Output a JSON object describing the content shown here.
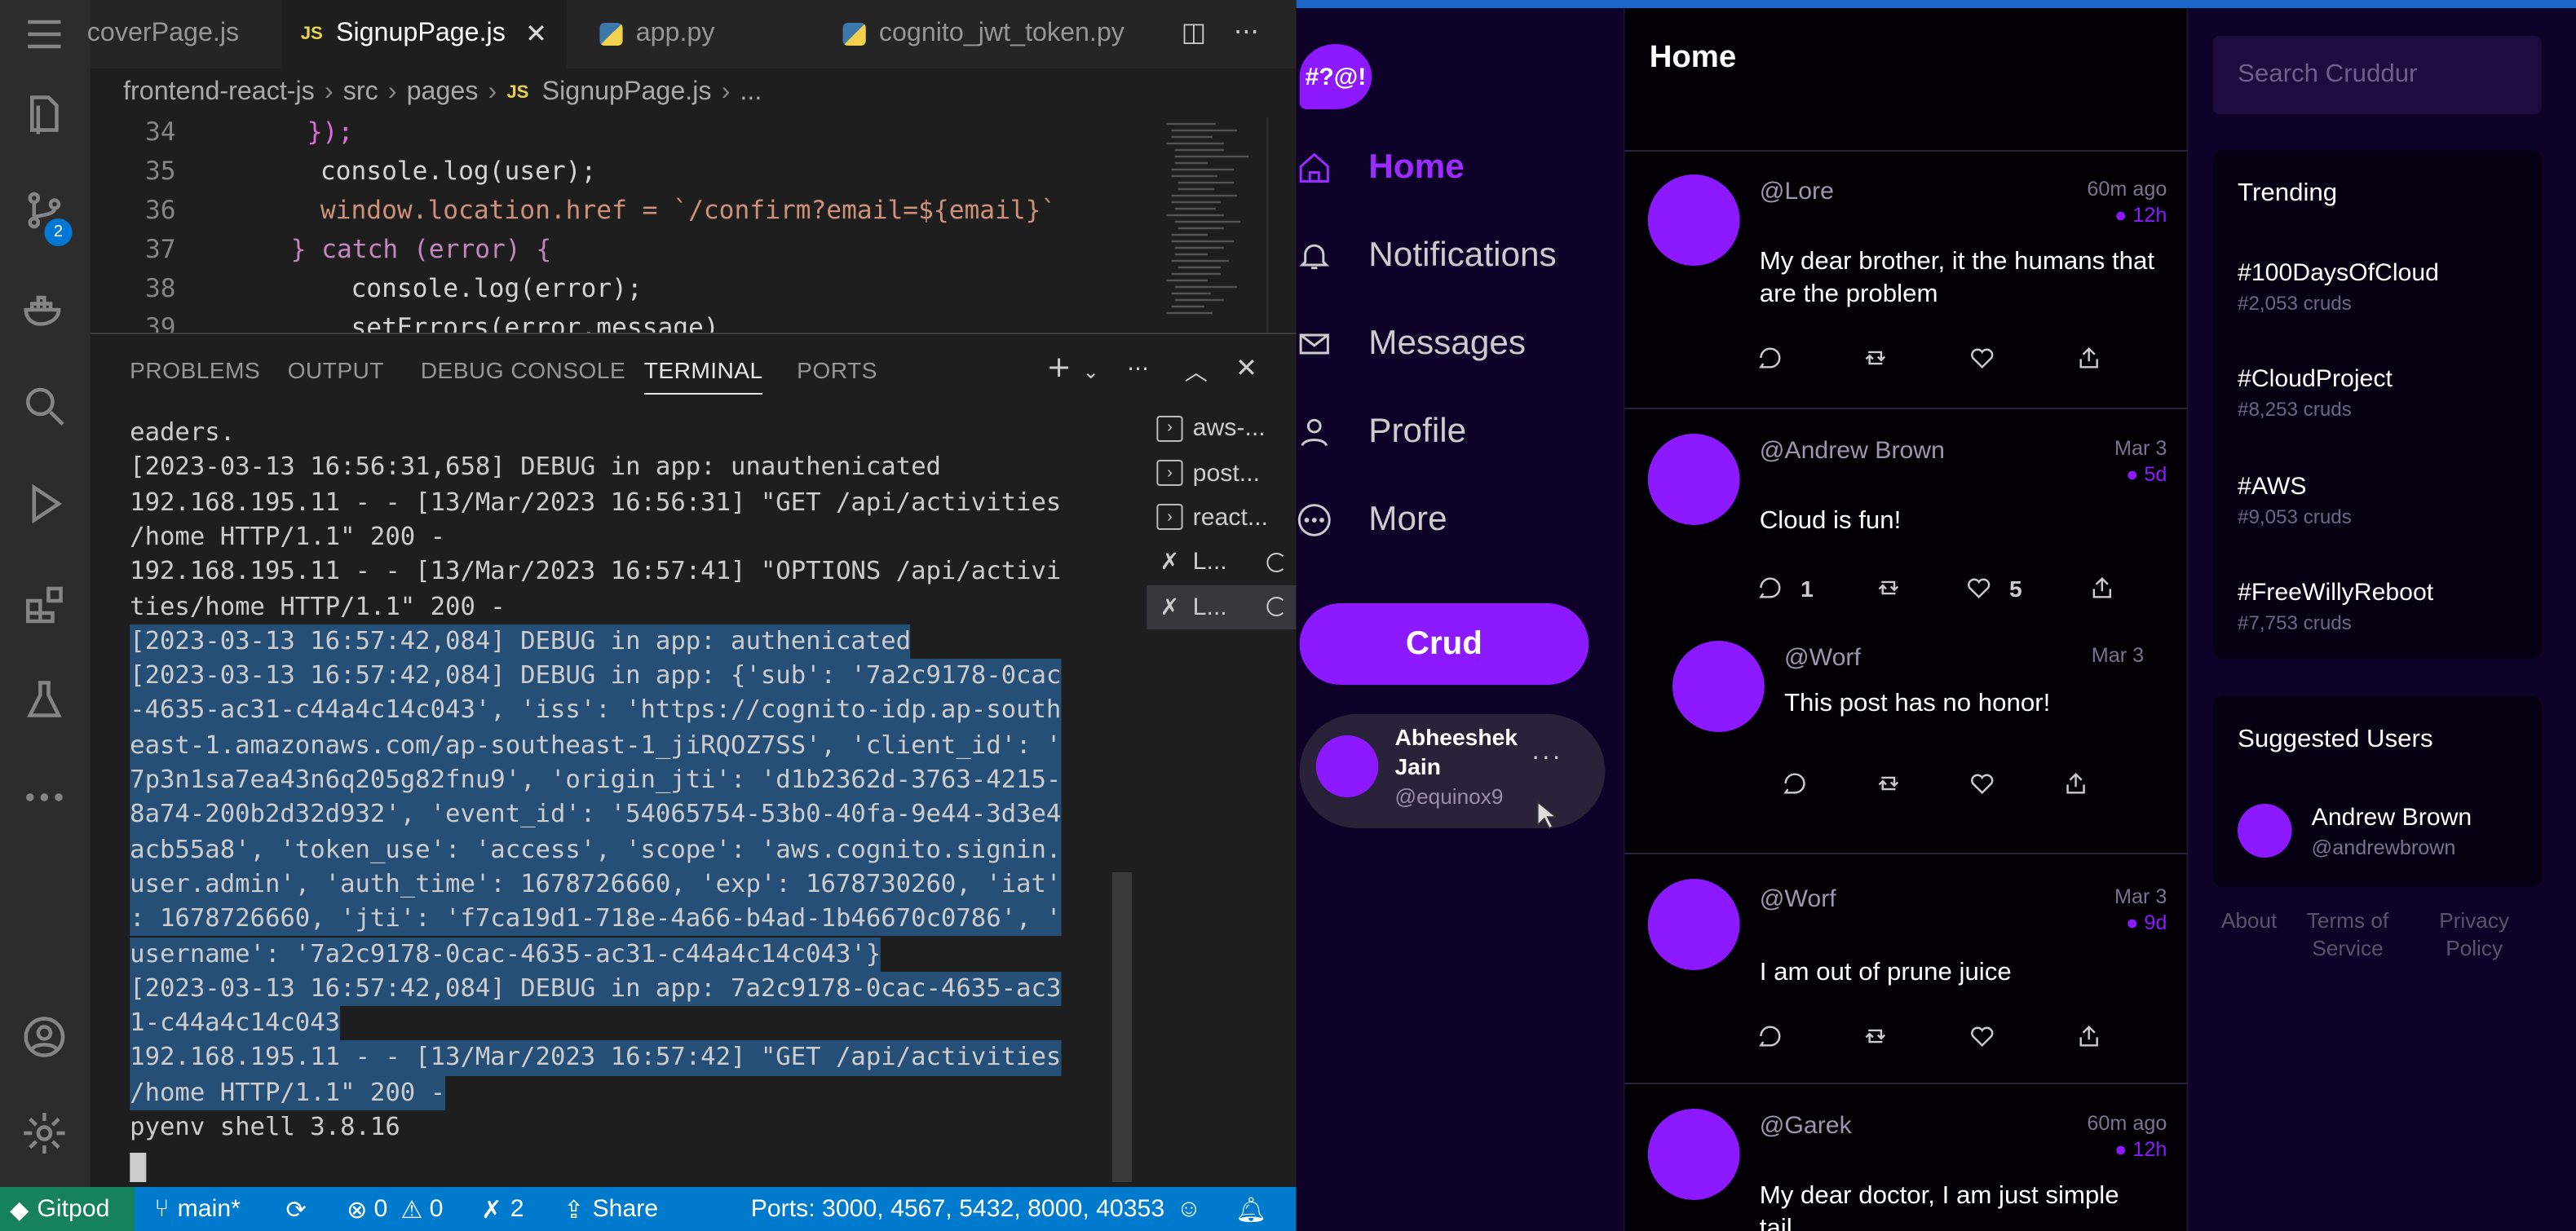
{
  "vscode": {
    "tabs": [
      {
        "label": "coverPage.js",
        "type": "js"
      },
      {
        "label": "SignupPage.js",
        "type": "js",
        "active": true
      },
      {
        "label": "app.py",
        "type": "py"
      },
      {
        "label": "cognito_jwt_token.py",
        "type": "py"
      }
    ],
    "breadcrumb": [
      "frontend-react-js",
      "src",
      "pages",
      "SignupPage.js",
      "..."
    ],
    "code_lines": [
      {
        "num": "34",
        "text": "});"
      },
      {
        "num": "35",
        "text": "console.log(user);"
      },
      {
        "num": "36",
        "text": "window.location.href = `/confirm?email=${email}`"
      },
      {
        "num": "37",
        "text": "} catch (error) {"
      },
      {
        "num": "38",
        "text": "  console.log(error);"
      },
      {
        "num": "39",
        "text": "  setErrors(error.message)"
      }
    ],
    "panel_tabs": [
      "PROBLEMS",
      "OUTPUT",
      "DEBUG CONSOLE",
      "TERMINAL",
      "PORTS"
    ],
    "terminal_lines": [
      "eaders.",
      "[2023-03-13 16:56:31,658] DEBUG in app: unauthenicated",
      "192.168.195.11 - - [13/Mar/2023 16:56:31] \"GET /api/activities",
      "/home HTTP/1.1\" 200 -",
      "192.168.195.11 - - [13/Mar/2023 16:57:41] \"OPTIONS /api/activi",
      "ties/home HTTP/1.1\" 200 -",
      "[2023-03-13 16:57:42,084] DEBUG in app: authenicated",
      "[2023-03-13 16:57:42,084] DEBUG in app: {'sub': '7a2c9178-0cac",
      "-4635-ac31-c44a4c14c043', 'iss': 'https://cognito-idp.ap-south",
      "east-1.amazonaws.com/ap-southeast-1_jiRQOZ7SS', 'client_id': '",
      "7p3n1sa7ea43n6q205g82fnu9', 'origin_jti': 'd1b2362d-3763-4215-",
      "8a74-200b2d32d932', 'event_id': '54065754-53b0-40fa-9e44-3d3e4",
      "acb55a8', 'token_use': 'access', 'scope': 'aws.cognito.signin.",
      "user.admin', 'auth_time': 1678726660, 'exp': 1678730260, 'iat'",
      ": 1678726660, 'jti': 'f7ca19d1-718e-4a66-b4ad-1b46670c0786', '",
      "username': '7a2c9178-0cac-4635-ac31-c44a4c14c043'}",
      "[2023-03-13 16:57:42,084] DEBUG in app: 7a2c9178-0cac-4635-ac3",
      "1-c44a4c14c043",
      "192.168.195.11 - - [13/Mar/2023 16:57:42] \"GET /api/activities",
      "/home HTTP/1.1\" 200 -",
      "pyenv shell 3.8.16"
    ],
    "terminal_list": [
      "aws-...",
      "post...",
      "react...",
      "L...",
      "L..."
    ],
    "source_control_badge": "2",
    "status": {
      "gitpod": "Gitpod",
      "branch": "main*",
      "errors": "0",
      "warnings": "0",
      "ports_count": "2",
      "share": "Share",
      "ports": "Ports: 3000, 4567, 5432, 8000, 40353"
    }
  },
  "cruddur": {
    "logo_text": "#?@!",
    "nav": [
      {
        "label": "Home",
        "icon": "home-icon",
        "active": true
      },
      {
        "label": "Notifications",
        "icon": "bell-icon"
      },
      {
        "label": "Messages",
        "icon": "mail-icon"
      },
      {
        "label": "Profile",
        "icon": "user-icon"
      },
      {
        "label": "More",
        "icon": "more-icon"
      }
    ],
    "crud_button": "Crud",
    "user": {
      "name": "Abheeshek Jain",
      "handle": "@equinox9"
    },
    "page_title": "Home",
    "activities": [
      {
        "handle": "@Lore",
        "time": "60m ago",
        "expires": "12h",
        "message": "My dear brother, it the humans that are the problem",
        "replies": "",
        "likes": ""
      },
      {
        "handle": "@Andrew Brown",
        "time": "Mar 3",
        "expires": "5d",
        "message": "Cloud is fun!",
        "replies": "1",
        "likes": "5"
      },
      {
        "handle": "@Worf",
        "time": "Mar 3",
        "expires": "",
        "message": "This post has no honor!",
        "replies": "",
        "likes": ""
      },
      {
        "handle": "@Worf",
        "time": "Mar 3",
        "expires": "9d",
        "message": "I am out of prune juice",
        "replies": "",
        "likes": ""
      },
      {
        "handle": "@Garek",
        "time": "60m ago",
        "expires": "12h",
        "message": "My dear doctor, I am just simple tail...",
        "replies": "",
        "likes": ""
      }
    ],
    "search_placeholder": "Search Cruddur",
    "trending_title": "Trending",
    "trending": [
      {
        "tag": "#100DaysOfCloud",
        "count": "#2,053 cruds"
      },
      {
        "tag": "#CloudProject",
        "count": "#8,253 cruds"
      },
      {
        "tag": "#AWS",
        "count": "#9,053 cruds"
      },
      {
        "tag": "#FreeWillyReboot",
        "count": "#7,753 cruds"
      }
    ],
    "suggested_title": "Suggested Users",
    "suggested": [
      {
        "name": "Andrew Brown",
        "handle": "@andrewbrown"
      }
    ],
    "footer": [
      "About",
      "Terms of Service",
      "Privacy Policy"
    ],
    "colors": {
      "accent": "#8c19ff",
      "bg": "#0e0228"
    }
  }
}
